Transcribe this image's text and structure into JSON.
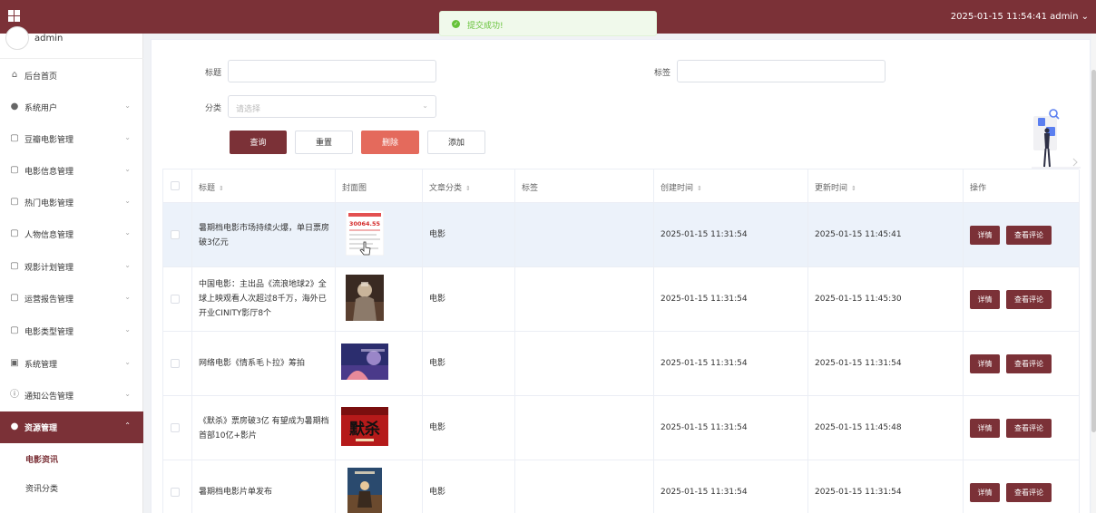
{
  "header": {
    "datetime": "2025-01-15 11:54:41",
    "user": "admin"
  },
  "toast": {
    "message": "提交成功!"
  },
  "sidebar": {
    "user_name": "admin",
    "items": [
      {
        "label": "后台首页",
        "icon": "home-icon"
      },
      {
        "label": "系统用户",
        "icon": "user-icon"
      },
      {
        "label": "豆瓣电影管理",
        "icon": "document-icon"
      },
      {
        "label": "电影信息管理",
        "icon": "document-icon"
      },
      {
        "label": "热门电影管理",
        "icon": "document-icon"
      },
      {
        "label": "人物信息管理",
        "icon": "document-icon"
      },
      {
        "label": "观影计划管理",
        "icon": "document-icon"
      },
      {
        "label": "运营报告管理",
        "icon": "document-icon"
      },
      {
        "label": "电影类型管理",
        "icon": "document-icon"
      },
      {
        "label": "系统管理",
        "icon": "image-icon"
      },
      {
        "label": "通知公告管理",
        "icon": "info-icon"
      },
      {
        "label": "资源管理",
        "icon": "location-pin-icon"
      }
    ],
    "sub_items": [
      "电影资讯",
      "资讯分类"
    ]
  },
  "search": {
    "title_label": "标题",
    "tag_label": "标签",
    "category_label": "分类",
    "category_placeholder": "请选择",
    "title_value": "",
    "tag_value": ""
  },
  "buttons": {
    "query": "查询",
    "reset": "重置",
    "delete": "删除",
    "add": "添加"
  },
  "table": {
    "columns": [
      "标题",
      "封面图",
      "文章分类",
      "标签",
      "创建时间",
      "更新时间",
      "操作"
    ],
    "detail_label": "详情",
    "comments_label": "查看评论",
    "rows": [
      {
        "title_lines": [
          "暑期档电影市场持续火爆，单日票房",
          "破3亿元"
        ],
        "category": "电影",
        "tag": "",
        "created": "2025-01-15 11:31:54",
        "updated": "2025-01-15 11:45:41",
        "thumb_text": "30064.55"
      },
      {
        "title_lines": [
          "中国电影：主出品《流浪地球2》全",
          "球上映观看人次超过8千万，海外已",
          "开业CINITY影厅8个"
        ],
        "category": "电影",
        "tag": "",
        "created": "2025-01-15 11:31:54",
        "updated": "2025-01-15 11:45:30",
        "thumb_text": ""
      },
      {
        "title_lines": [
          "网络电影《情系毛卜拉》筹拍"
        ],
        "category": "电影",
        "tag": "",
        "created": "2025-01-15 11:31:54",
        "updated": "2025-01-15 11:31:54",
        "thumb_text": ""
      },
      {
        "title_lines": [
          "《默杀》票房破3亿 有望成为暑期档",
          "首部10亿+影片"
        ],
        "category": "电影",
        "tag": "",
        "created": "2025-01-15 11:31:54",
        "updated": "2025-01-15 11:45:48",
        "thumb_text": "默杀"
      },
      {
        "title_lines": [
          "暑期档电影片单发布"
        ],
        "category": "电影",
        "tag": "",
        "created": "2025-01-15 11:31:54",
        "updated": "2025-01-15 11:31:54",
        "thumb_text": ""
      }
    ]
  },
  "colors": {
    "brand": "#7b3137",
    "danger": "#e46a5c",
    "success": "#67c23a"
  }
}
